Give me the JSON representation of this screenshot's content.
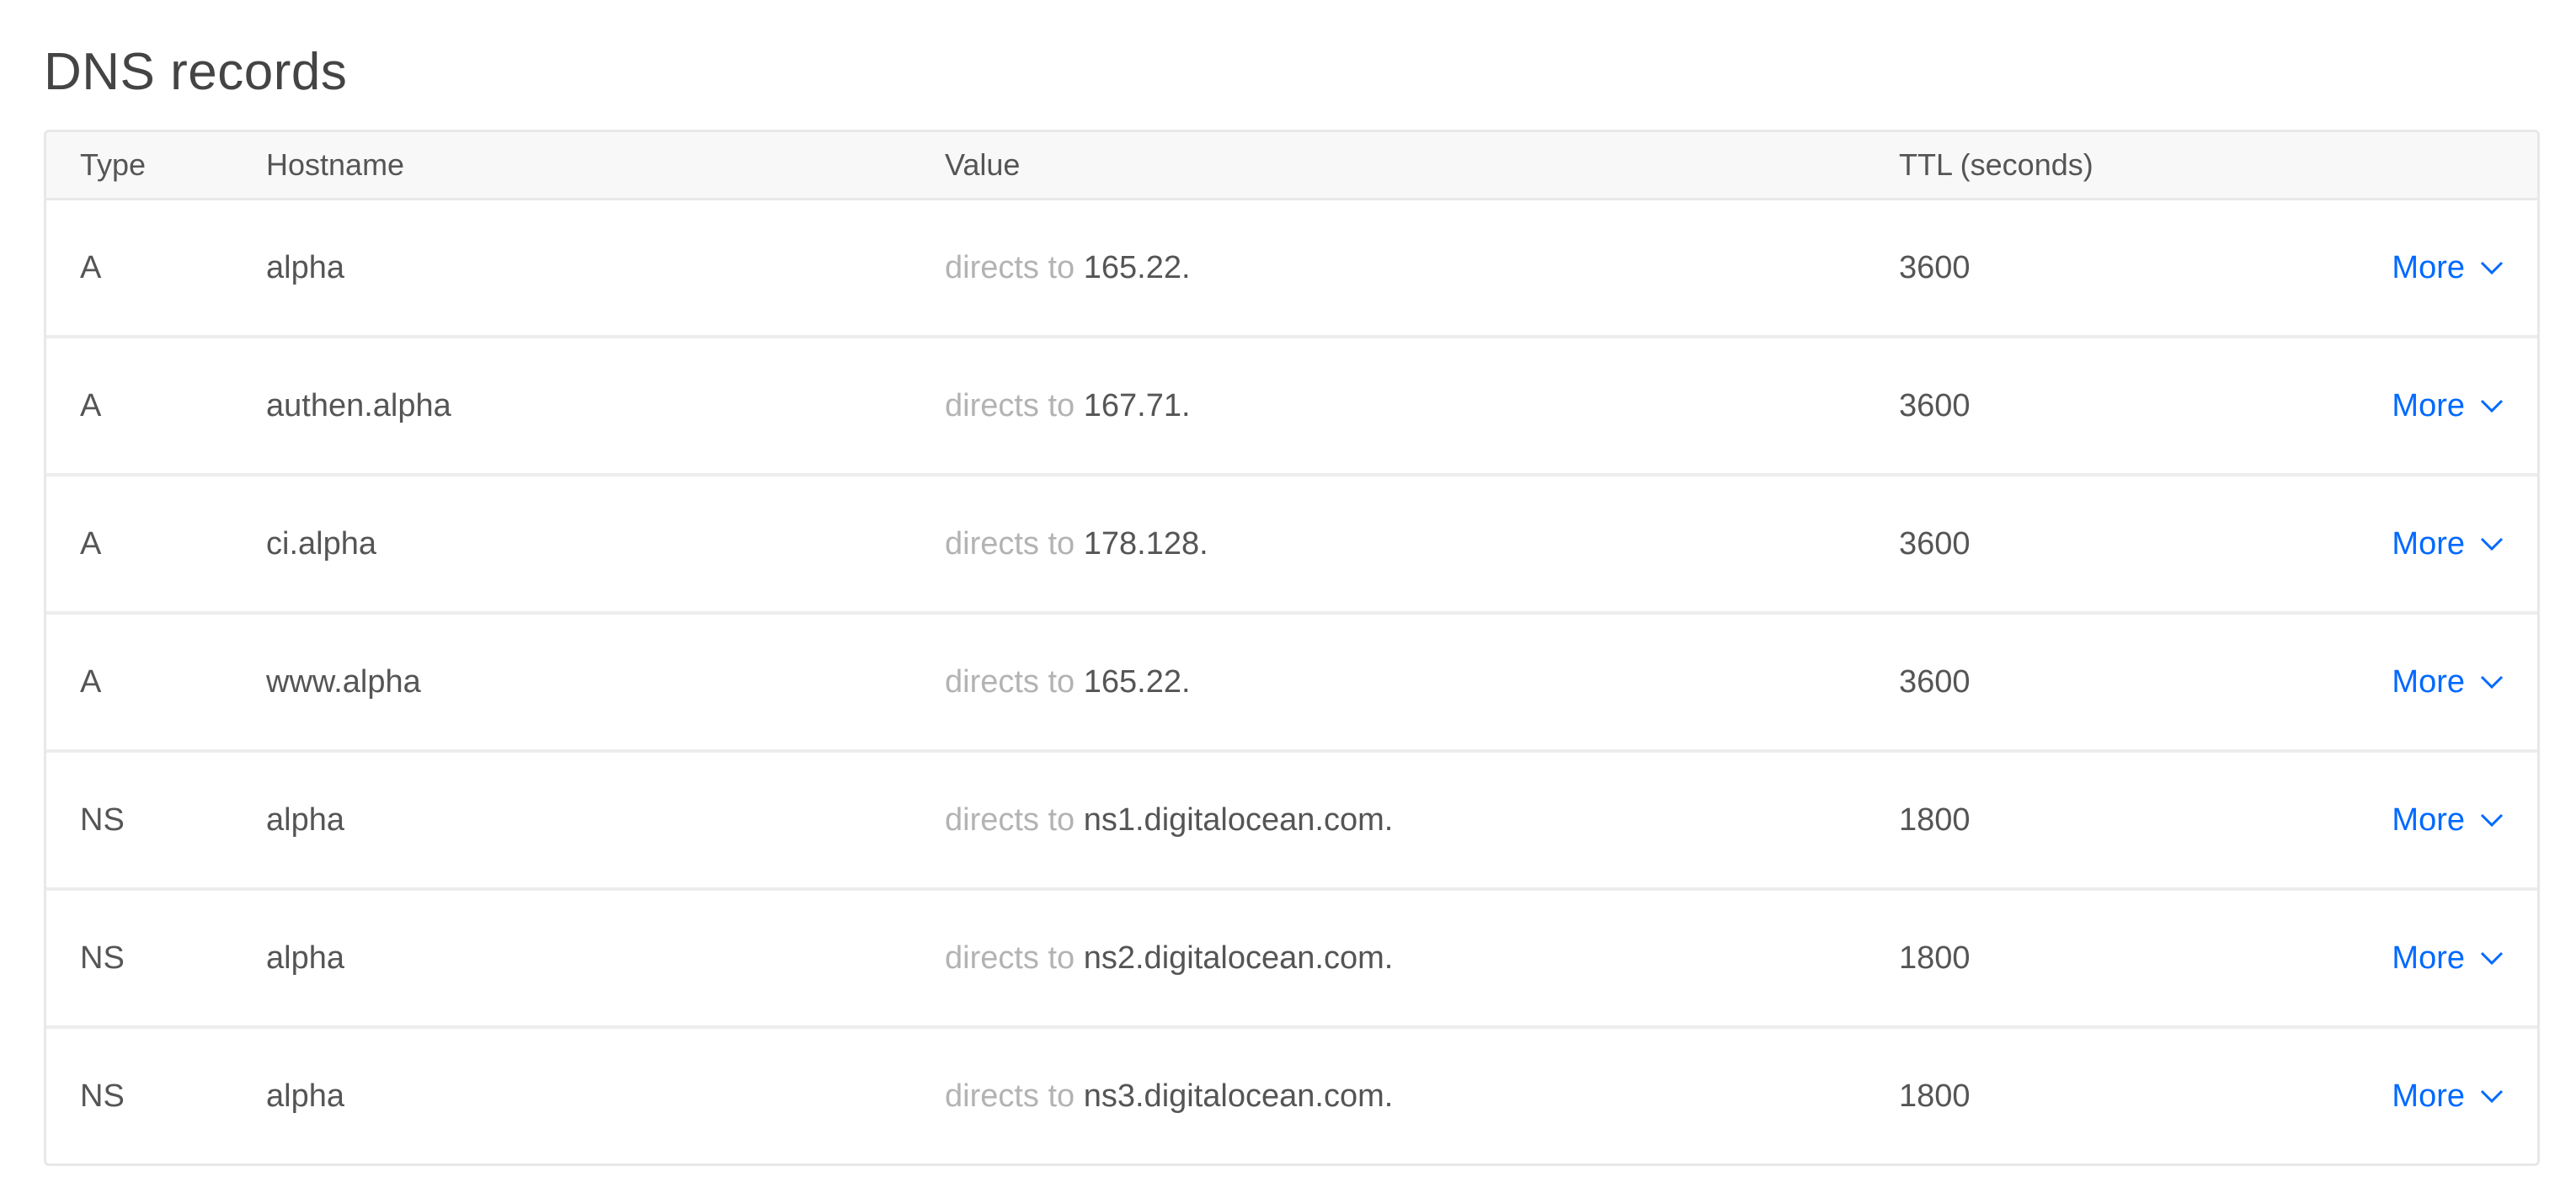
{
  "page": {
    "title": "DNS records"
  },
  "table": {
    "headers": {
      "type": "Type",
      "hostname": "Hostname",
      "value": "Value",
      "ttl": "TTL (seconds)"
    },
    "rows": [
      {
        "type": "A",
        "hostname": "alpha",
        "value_prefix": "directs to",
        "value": "165.22.",
        "ttl": "3600",
        "action": "More"
      },
      {
        "type": "A",
        "hostname": "authen.alpha",
        "value_prefix": "directs to",
        "value": "167.71.",
        "ttl": "3600",
        "action": "More"
      },
      {
        "type": "A",
        "hostname": "ci.alpha",
        "value_prefix": "directs to",
        "value": "178.128.",
        "ttl": "3600",
        "action": "More"
      },
      {
        "type": "A",
        "hostname": "www.alpha",
        "value_prefix": "directs to",
        "value": "165.22.",
        "ttl": "3600",
        "action": "More"
      },
      {
        "type": "NS",
        "hostname": "alpha",
        "value_prefix": "directs to",
        "value": "ns1.digitalocean.com.",
        "ttl": "1800",
        "action": "More"
      },
      {
        "type": "NS",
        "hostname": "alpha",
        "value_prefix": "directs to",
        "value": "ns2.digitalocean.com.",
        "ttl": "1800",
        "action": "More"
      },
      {
        "type": "NS",
        "hostname": "alpha",
        "value_prefix": "directs to",
        "value": "ns3.digitalocean.com.",
        "ttl": "1800",
        "action": "More"
      }
    ]
  },
  "icons": {
    "more_toggle": "chevron-down-icon"
  },
  "colors": {
    "link": "#0069ff",
    "muted_text": "#b3b3b3",
    "text": "#555555",
    "border": "#e8e8e8",
    "header_bg": "#f8f8f8"
  }
}
